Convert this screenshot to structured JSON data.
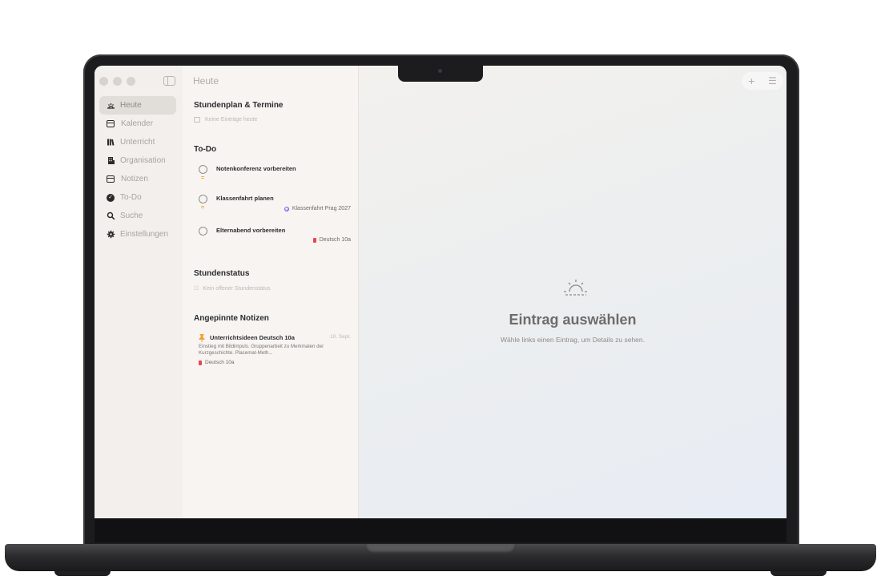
{
  "window": {
    "title": "Heute"
  },
  "sidebar": {
    "items": [
      {
        "label": "Heute",
        "icon": "sunrise-icon",
        "active": true
      },
      {
        "label": "Kalender",
        "icon": "calendar-icon",
        "active": false
      },
      {
        "label": "Unterricht",
        "icon": "books-icon",
        "active": false
      },
      {
        "label": "Organisation",
        "icon": "building-icon",
        "active": false
      },
      {
        "label": "Notizen",
        "icon": "note-icon",
        "active": false
      },
      {
        "label": "To-Do",
        "icon": "checkmark-circle-icon",
        "active": false
      },
      {
        "label": "Suche",
        "icon": "search-icon",
        "active": false
      },
      {
        "label": "Einstellungen",
        "icon": "gear-icon",
        "active": false
      }
    ]
  },
  "today": {
    "schedule": {
      "title": "Stundenplan & Termine",
      "empty": "Keine Einträge heute"
    },
    "todo": {
      "title": "To-Do",
      "items": [
        {
          "title": "Notenkonferenz vorbereiten",
          "tag": ""
        },
        {
          "title": "Klassenfahrt planen",
          "tag": "Klassenfahrt Prag 2027"
        },
        {
          "title": "Elternabend vorbereiten",
          "tag": "Deutsch 10a"
        }
      ]
    },
    "status": {
      "title": "Stundenstatus",
      "empty": "Kein offener Stundenstatus"
    },
    "pinned": {
      "title": "Angepinnte Notizen",
      "note": {
        "title": "Unterrichtsideen Deutsch 10a",
        "date": "10. Sept.",
        "body": "Einstieg mit Bildimpuls. Gruppenarbeit zu Merkmalen der Kurzgeschichte. Placemat-Meth...",
        "tag": "Deutsch 10a"
      }
    }
  },
  "detail": {
    "empty_title": "Eintrag auswählen",
    "empty_subtitle": "Wähle links einen Eintrag, um Details zu sehen."
  },
  "colors": {
    "accent_orange": "#f0a030",
    "tag_purple": "#8a5cf5",
    "tag_red": "#e5484d"
  }
}
